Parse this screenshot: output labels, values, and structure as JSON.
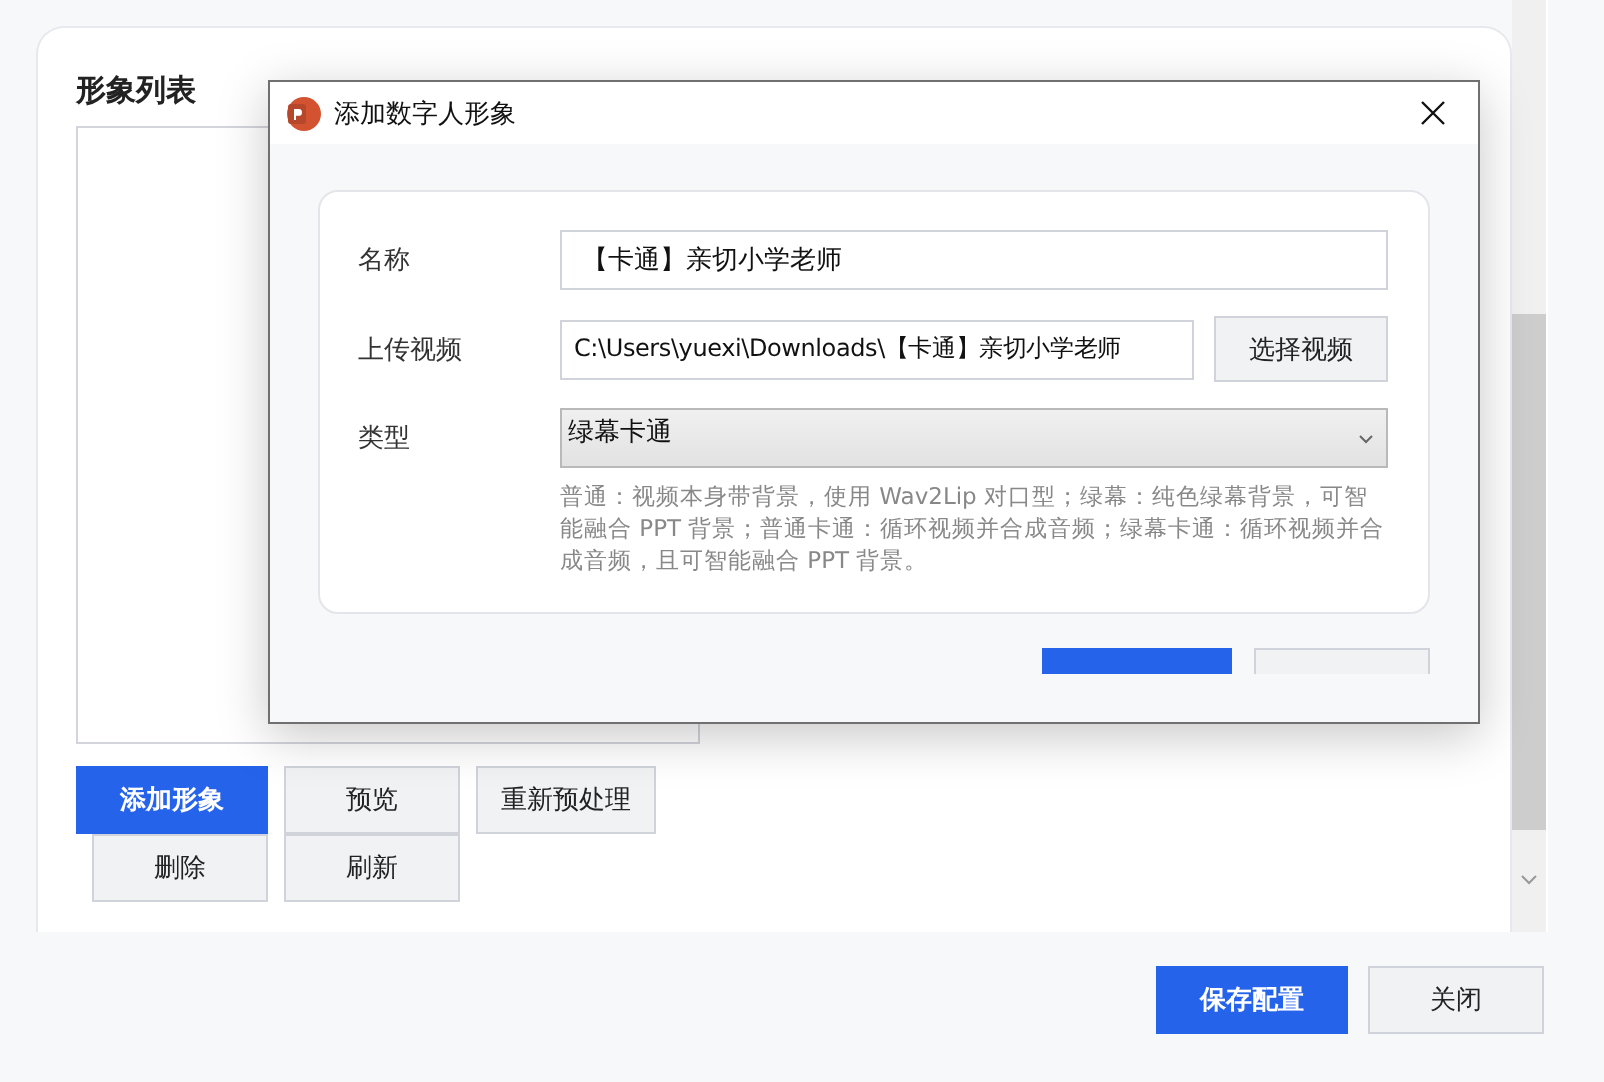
{
  "panel": {
    "title": "形象列表",
    "buttons": [
      {
        "label": "添加形象",
        "kind": "primary"
      },
      {
        "label": "预览",
        "kind": "default"
      },
      {
        "label": "重新预处理",
        "kind": "default"
      },
      {
        "label": "删除",
        "kind": "default"
      },
      {
        "label": "刷新",
        "kind": "default"
      }
    ]
  },
  "footer_buttons": [
    {
      "label": "保存配置",
      "kind": "primary"
    },
    {
      "label": "关闭",
      "kind": "default"
    }
  ],
  "dialog": {
    "title": "添加数字人形象",
    "fields": [
      {
        "label": "名称",
        "kind": "input",
        "value": "【卡通】亲切小学老师"
      },
      {
        "label": "上传视频",
        "kind": "file",
        "value": "C:\\Users\\yuexi\\Downloads\\【卡通】亲切小学老师",
        "button": "选择视频"
      },
      {
        "label": "类型",
        "kind": "select",
        "value": "绿幕卡通",
        "help": "普通：视频本身带背景，使用 Wav2Lip 对口型；绿幕：纯色绿幕背景，可智能融合 PPT 背景；普通卡通：循环视频并合成音频；绿幕卡通：循环视频并合成音频，且可智能融合 PPT 背景。"
      }
    ],
    "buttons": [
      {
        "kind": "primary"
      },
      {
        "kind": "default"
      }
    ]
  }
}
